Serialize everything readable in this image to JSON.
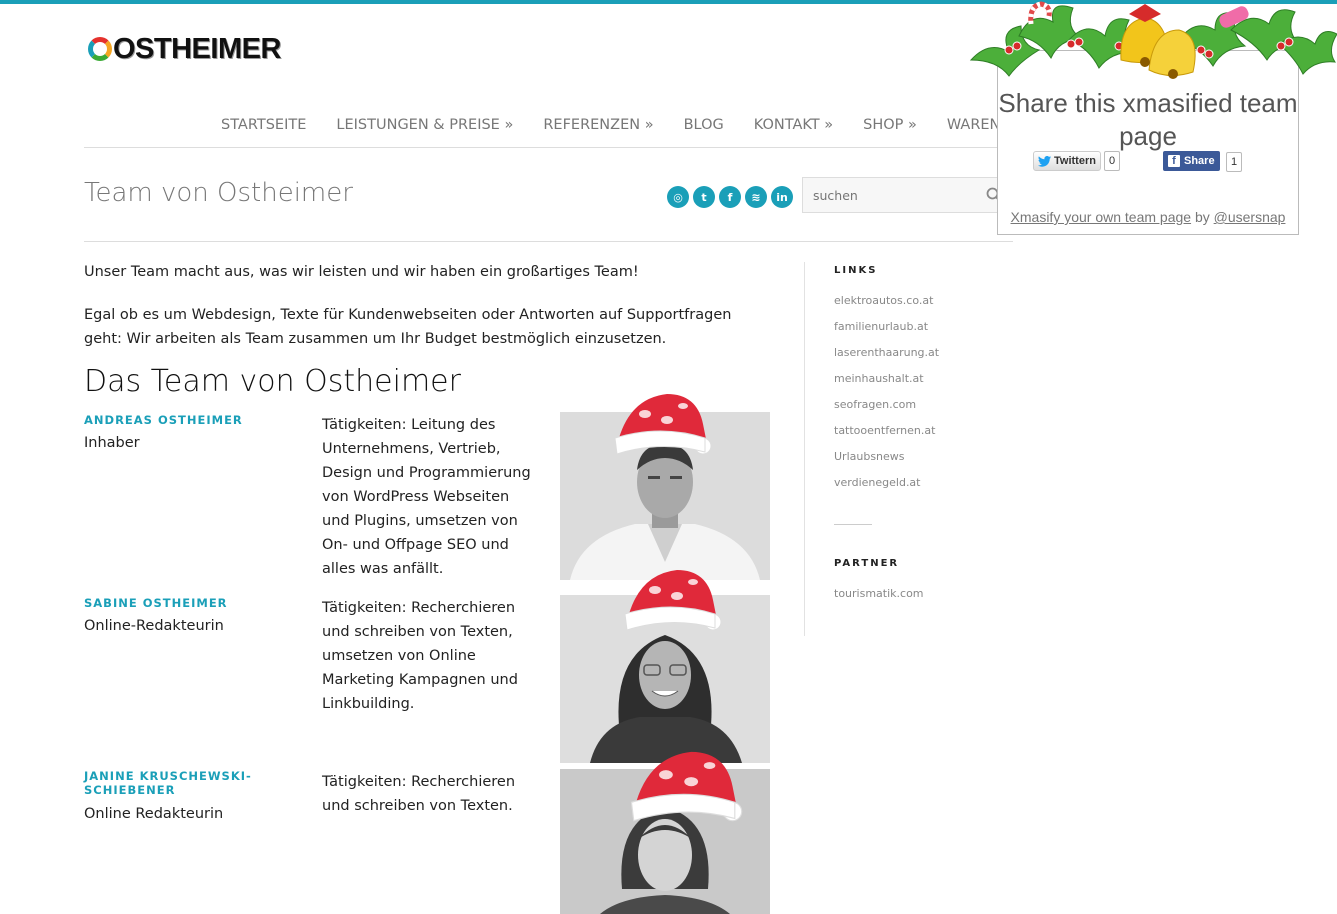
{
  "brand": {
    "name": "OSTHEIMER"
  },
  "nav": [
    "STARTSEITE",
    "LEISTUNGEN & PREISE »",
    "REFERENZEN »",
    "BLOG",
    "KONTAKT »",
    "SHOP »",
    "WARENKORB"
  ],
  "page": {
    "title": "Team von Ostheimer"
  },
  "social": [
    "dribbble-icon",
    "twitter-icon",
    "facebook-icon",
    "rss-icon",
    "linkedin-icon"
  ],
  "search": {
    "placeholder": "suchen"
  },
  "intro": [
    "Unser Team macht aus, was wir leisten und wir haben ein großartiges Team!",
    "Egal ob es um Webdesign, Texte für Kundenwebseiten oder Antworten auf Supportfragen geht: Wir arbeiten als Team zusammen um Ihr Budget bestmöglich einzusetzen."
  ],
  "team": {
    "heading": "Das Team von Ostheimer",
    "members": [
      {
        "name": "ANDREAS OSTHEIMER",
        "role": "Inhaber",
        "tasks": "Tätigkeiten: Leitung des Unternehmens, Vertrieb, Design und Programmierung von WordPress Webseiten und Plugins, umsetzen von On- und Offpage SEO und alles was anfällt."
      },
      {
        "name": "SABINE OSTHEIMER",
        "role": "Online-Redakteurin",
        "tasks": "Tätigkeiten: Recherchieren und schreiben von Texten, umsetzen von Online Marketing Kampagnen und Linkbuilding."
      },
      {
        "name": "JANINE KRUSCHEWSKI-SCHIEBENER",
        "role": "Online Redakteurin",
        "tasks": "Tätigkeiten: Recherchieren und schreiben von Texten."
      }
    ]
  },
  "sidebar": {
    "links_heading": "LINKS",
    "links": [
      "elektroautos.co.at",
      "familienurlaub.at",
      "laserenthaarung.at",
      "meinhaushalt.at",
      "seofragen.com",
      "tattooentfernen.at",
      "Urlaubsnews",
      "verdienegeld.at"
    ],
    "partner_heading": "PARTNER",
    "partners": [
      "tourismatik.com"
    ]
  },
  "share_popup": {
    "title": "Share this xmasified team page",
    "twitter_label": "Twittern",
    "twitter_count": "0",
    "facebook_label": "Share",
    "facebook_count": "1",
    "footer_link": "Xmasify your own team page",
    "footer_by": "by",
    "footer_handle": "@usersnap"
  },
  "colors": {
    "accent": "#1a9fb8",
    "hat_red": "#e0293a",
    "facebook": "#3b5998"
  }
}
